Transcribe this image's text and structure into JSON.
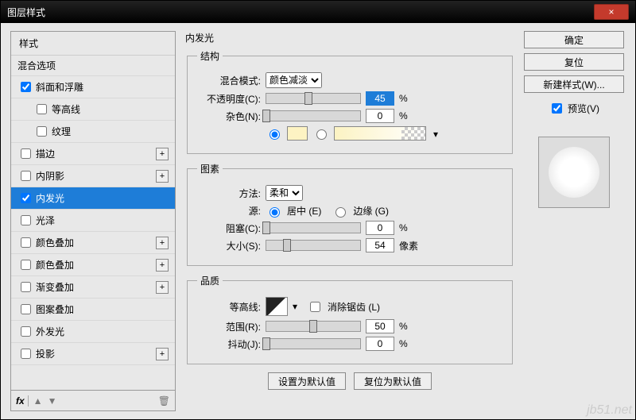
{
  "window": {
    "title": "图层样式",
    "close": "×"
  },
  "styles": {
    "header": "样式",
    "blend_options": "混合选项",
    "bevel": {
      "label": "斜面和浮雕",
      "checked": true
    },
    "contour_sub": {
      "label": "等高线",
      "checked": false
    },
    "texture_sub": {
      "label": "纹理",
      "checked": false
    },
    "stroke": {
      "label": "描边",
      "checked": false
    },
    "inner_shadow": {
      "label": "内阴影",
      "checked": false
    },
    "inner_glow": {
      "label": "内发光",
      "checked": true
    },
    "satin": {
      "label": "光泽",
      "checked": false
    },
    "color_overlay1": {
      "label": "颜色叠加",
      "checked": false
    },
    "color_overlay2": {
      "label": "颜色叠加",
      "checked": false
    },
    "grad_overlay": {
      "label": "渐变叠加",
      "checked": false
    },
    "pattern_overlay": {
      "label": "图案叠加",
      "checked": false
    },
    "outer_glow": {
      "label": "外发光",
      "checked": false
    },
    "drop_shadow": {
      "label": "投影",
      "checked": false
    },
    "fx": "fx"
  },
  "panel": {
    "title": "内发光",
    "structure": {
      "legend": "结构",
      "blend_mode_label": "混合模式:",
      "blend_mode_value": "颜色减淡",
      "opacity_label": "不透明度(C):",
      "opacity_value": "45",
      "noise_label": "杂色(N):",
      "noise_value": "0",
      "percent": "%",
      "swatch_color": "#fdf3c3"
    },
    "elements": {
      "legend": "图素",
      "technique_label": "方法:",
      "technique_value": "柔和",
      "source_label": "源:",
      "center": "居中 (E)",
      "edge": "边缘 (G)",
      "choke_label": "阻塞(C):",
      "choke_value": "0",
      "size_label": "大小(S):",
      "size_value": "54",
      "px": "像素",
      "percent": "%"
    },
    "quality": {
      "legend": "品质",
      "contour_label": "等高线:",
      "antialias": "消除锯齿 (L)",
      "range_label": "范围(R):",
      "range_value": "50",
      "jitter_label": "抖动(J):",
      "jitter_value": "0",
      "percent": "%"
    },
    "defaults": {
      "make": "设置为默认值",
      "reset": "复位为默认值"
    }
  },
  "right": {
    "ok": "确定",
    "cancel": "复位",
    "new_style": "新建样式(W)...",
    "preview": "预览(V)"
  },
  "watermark": "jb51.net"
}
